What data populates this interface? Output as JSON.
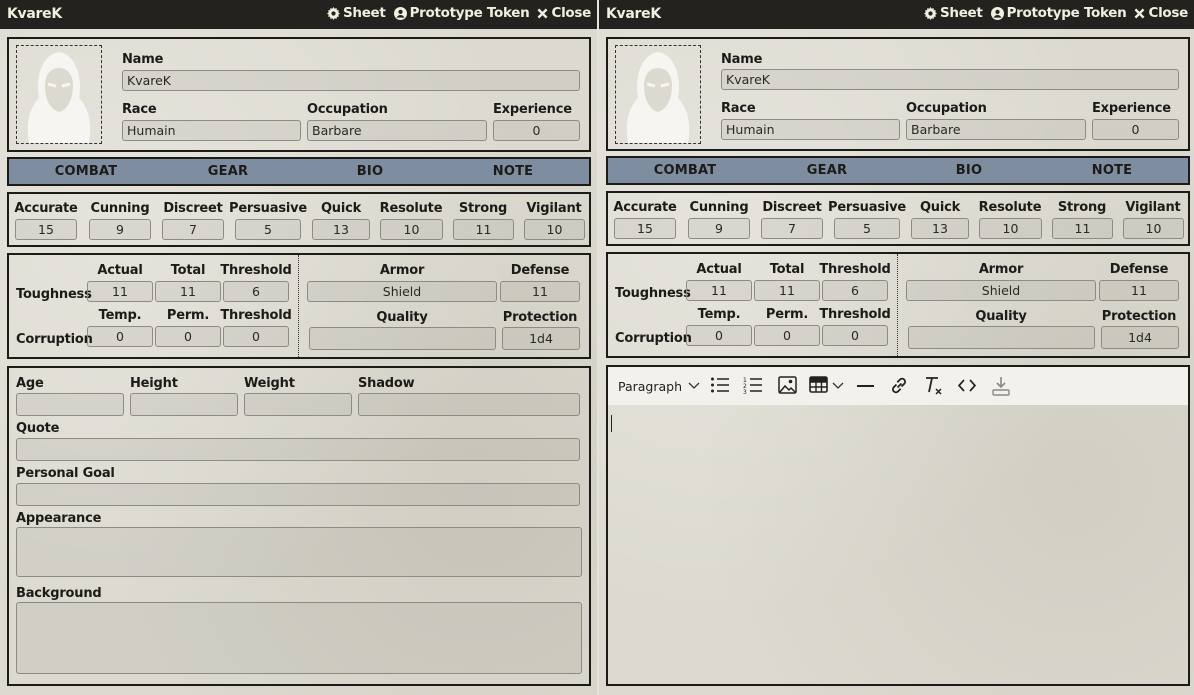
{
  "actor_name": "KvareK",
  "header_controls": {
    "sheet": "Sheet",
    "prototype_token": "Prototype Token",
    "close": "Close"
  },
  "identity": {
    "name_label": "Name",
    "name_value": "KvareK",
    "race_label": "Race",
    "race_value": "Humain",
    "occupation_label": "Occupation",
    "occupation_value": "Barbare",
    "experience_label": "Experience",
    "experience_value": "0"
  },
  "tabs": [
    "COMBAT",
    "GEAR",
    "BIO",
    "NOTE"
  ],
  "attributes": [
    {
      "label": "Accurate",
      "value": "15"
    },
    {
      "label": "Cunning",
      "value": "9"
    },
    {
      "label": "Discreet",
      "value": "7"
    },
    {
      "label": "Persuasive",
      "value": "5"
    },
    {
      "label": "Quick",
      "value": "13"
    },
    {
      "label": "Resolute",
      "value": "10"
    },
    {
      "label": "Strong",
      "value": "11"
    },
    {
      "label": "Vigilant",
      "value": "10"
    }
  ],
  "toughness": {
    "label": "Toughness",
    "actual_label": "Actual",
    "actual": "11",
    "total_label": "Total",
    "total": "11",
    "threshold_label": "Threshold",
    "threshold": "6"
  },
  "corruption": {
    "label": "Corruption",
    "temp_label": "Temp.",
    "temp": "0",
    "perm_label": "Perm.",
    "perm": "0",
    "threshold_label": "Threshold",
    "threshold": "0"
  },
  "armor": {
    "armor_label": "Armor",
    "armor_value": "Shield",
    "defense_label": "Defense",
    "defense_value": "11",
    "quality_label": "Quality",
    "quality_value": "",
    "protection_label": "Protection",
    "protection_value": "1d4"
  },
  "bio": {
    "age_label": "Age",
    "age": "",
    "height_label": "Height",
    "height": "",
    "weight_label": "Weight",
    "weight": "",
    "shadow_label": "Shadow",
    "shadow": "",
    "quote_label": "Quote",
    "quote": "",
    "goal_label": "Personal Goal",
    "goal": "",
    "appearance_label": "Appearance",
    "appearance": "",
    "background_label": "Background",
    "background": ""
  },
  "editor": {
    "block_format": "Paragraph",
    "tools": [
      "bullet-list-icon",
      "numbered-list-icon",
      "image-icon",
      "table-icon",
      "horizontal-rule-icon",
      "link-icon",
      "clear-format-icon",
      "source-code-icon",
      "save-icon"
    ]
  },
  "colors": {
    "tab_bar": "#7f8da0",
    "title_bar": "#23221f",
    "parchment": "#dcdad0"
  }
}
